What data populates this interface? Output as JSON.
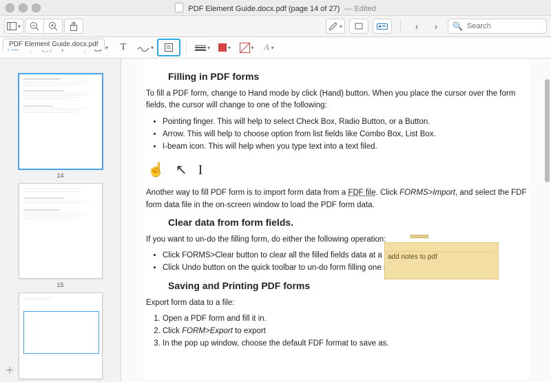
{
  "window": {
    "filename": "PDF Element Guide.docx.pdf",
    "page_info": "(page 14 of 27)",
    "edited": "— Edited"
  },
  "toolbar1": {
    "search_placeholder": "Search"
  },
  "tabs": {
    "doc_tab": "PDF Element Guide.docx.pdf"
  },
  "thumbs": {
    "p14": "14",
    "p15": "15"
  },
  "content": {
    "h1": "Filling in PDF forms",
    "p1": "To fill a PDF form, change to Hand mode by click (Hand) button. When you place the cursor over the form fields, the cursor will change to one of the following:",
    "b1": "Pointing finger. This will help to select Check Box, Radio Button, or a Button.",
    "b2": "Arrow. This will help to choose option from list fields like Combo Box, List Box.",
    "b3": "I-beam icon. This will help when you type text into a text filed.",
    "p2a": "Another way to fill PDF form is to import form data from a ",
    "p2b": "FDF file",
    "p2c": ". Click ",
    "p2d": "FORMS>Import",
    "p2e": ", and select the FDF form data file in the on-screen window to load the PDF form data.",
    "h2": "Clear data from form fields.",
    "p3": "If you want to un-do the filling form, do either the following operation:",
    "c1": "Click FORMS>Clear button to clear all the filled fields data at a time.",
    "c2": "Click Undo button on the quick toolbar to un-do form filling one step.",
    "h3": "Saving and Printing PDF forms",
    "p4": "Export form data to a file:",
    "o1": "Open a PDF form and fill it in.",
    "o2a": "Click ",
    "o2b": "FORM>Export",
    "o2c": " to export",
    "o3": "In the pop up window, choose the default FDF format to save as."
  },
  "note": {
    "text": "add notes to pdf"
  }
}
